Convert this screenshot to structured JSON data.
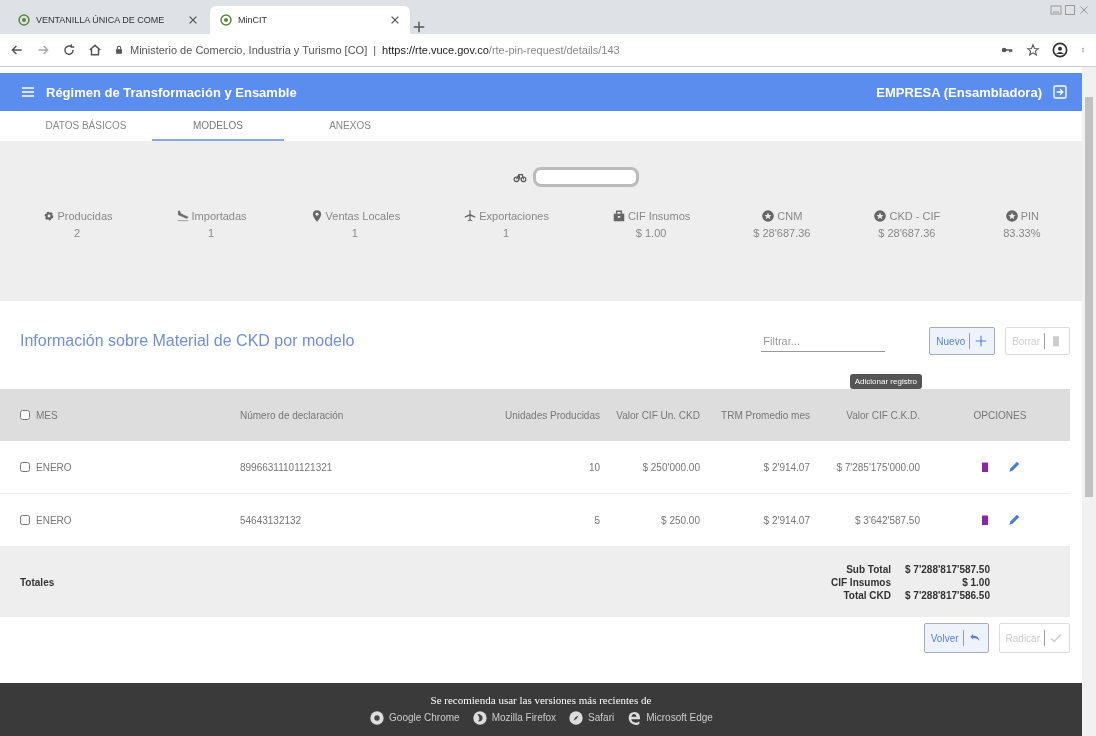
{
  "browser": {
    "tabs": [
      {
        "title": "VENTANILLA ÚNICA DE COME",
        "selected": false
      },
      {
        "title": "MinCIT",
        "selected": true
      }
    ],
    "address": {
      "site": "Ministerio de Comercio, Industria y Turismo [CO]",
      "separator": "|",
      "url_host": "https://rte.vuce.gov.co",
      "url_path": "/rte-pin-request/details/143"
    }
  },
  "app": {
    "title": "Régimen de Transformación y Ensamble",
    "user": "EMPRESA (Ensambladora)"
  },
  "tabs": [
    {
      "label": "DATOS BÁSICOS",
      "selected": false
    },
    {
      "label": "MODELOS",
      "selected": true
    },
    {
      "label": "ANEXOS",
      "selected": false
    }
  ],
  "stats": [
    {
      "label": "Producidas",
      "value": "2"
    },
    {
      "label": "Importadas",
      "value": "1"
    },
    {
      "label": "Ventas Locales",
      "value": "1"
    },
    {
      "label": "Exportaciones",
      "value": "1"
    },
    {
      "label": "CIF Insumos",
      "value": "$ 1.00"
    },
    {
      "label": "CNM",
      "value": "$ 28'687.36"
    },
    {
      "label": "CKD - CIF",
      "value": "$ 28'687.36"
    },
    {
      "label": "PIN",
      "value": "83.33%"
    }
  ],
  "section": {
    "title": "Información sobre Material de CKD por modelo",
    "filter_placeholder": "Filtrar...",
    "buttons": [
      {
        "label": "Nuevo",
        "disabled": false
      },
      {
        "label": "Borrar",
        "disabled": true
      }
    ],
    "tooltip": "Adicionar registro"
  },
  "table": {
    "header_checked": false,
    "columns": [
      "MES",
      "Número de declaración",
      "Unidades Producidas",
      "Valor CIF Un. CKD",
      "TRM Promedio mes",
      "Valor CIF C.K.D.",
      "OPCIONES"
    ],
    "rows": [
      {
        "checked": false,
        "cells": [
          "ENERO",
          "89966311101121321",
          "10",
          "$ 250'000.00",
          "$ 2'914.07",
          "$ 7'285'175'000.00"
        ]
      },
      {
        "checked": false,
        "cells": [
          "ENERO",
          "54643132132",
          "5",
          "$ 250.00",
          "$ 2'914.07",
          "$ 3'642'587.50"
        ]
      }
    ],
    "totals": {
      "label": "Totales",
      "items": [
        {
          "label": "Sub Total",
          "value": "$ 7'288'817'587.50"
        },
        {
          "label": "CIF Insumos",
          "value": "$ 1.00"
        },
        {
          "label": "Total CKD",
          "value": "$ 7'288'817'586.50"
        }
      ]
    }
  },
  "actions": [
    {
      "label": "Volver",
      "disabled": false
    },
    {
      "label": "Radicar",
      "disabled": true
    }
  ],
  "footer": {
    "note": "Se recomienda usar las versiones más recientes de",
    "browsers": [
      "Google Chrome",
      "Mozilla Firefox",
      "Safari",
      "Microsoft Edge"
    ]
  }
}
